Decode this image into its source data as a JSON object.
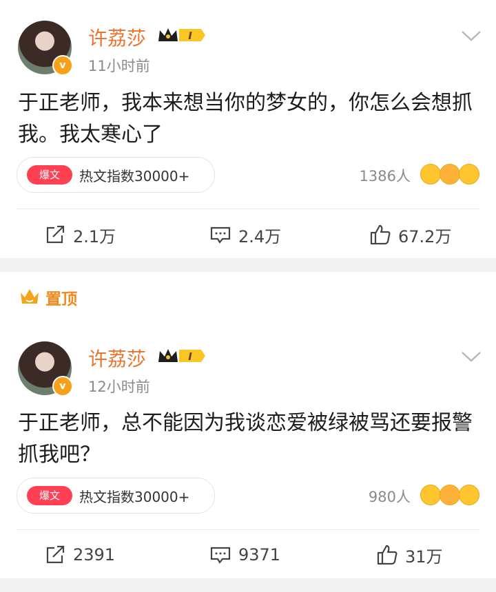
{
  "posts": [
    {
      "author": "许荔莎",
      "level_badge": "I",
      "verified_badge": "v",
      "time": "11小时前",
      "text": "于正老师，我本来想当你的梦女的，你怎么会想抓我。我太寒心了",
      "hot_tag": "爆文",
      "hot_text": "热文指数30000+",
      "people": "1386人",
      "reactions": [
        "shocked-emoji",
        "laughing-emoji",
        "grin-emoji"
      ],
      "repost": "2.1万",
      "comment": "2.4万",
      "like": "67.2万"
    },
    {
      "author": "许荔莎",
      "level_badge": "I",
      "verified_badge": "v",
      "time": "12小时前",
      "text": "于正老师，总不能因为我谈恋爱被绿被骂还要报警抓我吧？",
      "hot_tag": "爆文",
      "hot_text": "热文指数30000+",
      "people": "980人",
      "reactions": [
        "shocked-emoji",
        "laughing-emoji",
        "grin-emoji"
      ],
      "repost": "2391",
      "comment": "9371",
      "like": "31万"
    }
  ],
  "pinned": {
    "label": "置顶",
    "icon": "crown-icon"
  },
  "colors": {
    "accent": "#e8742e",
    "hot_tag": "#ff3f52",
    "pin": "#f08a1f",
    "separator": "#f2f2f2"
  }
}
